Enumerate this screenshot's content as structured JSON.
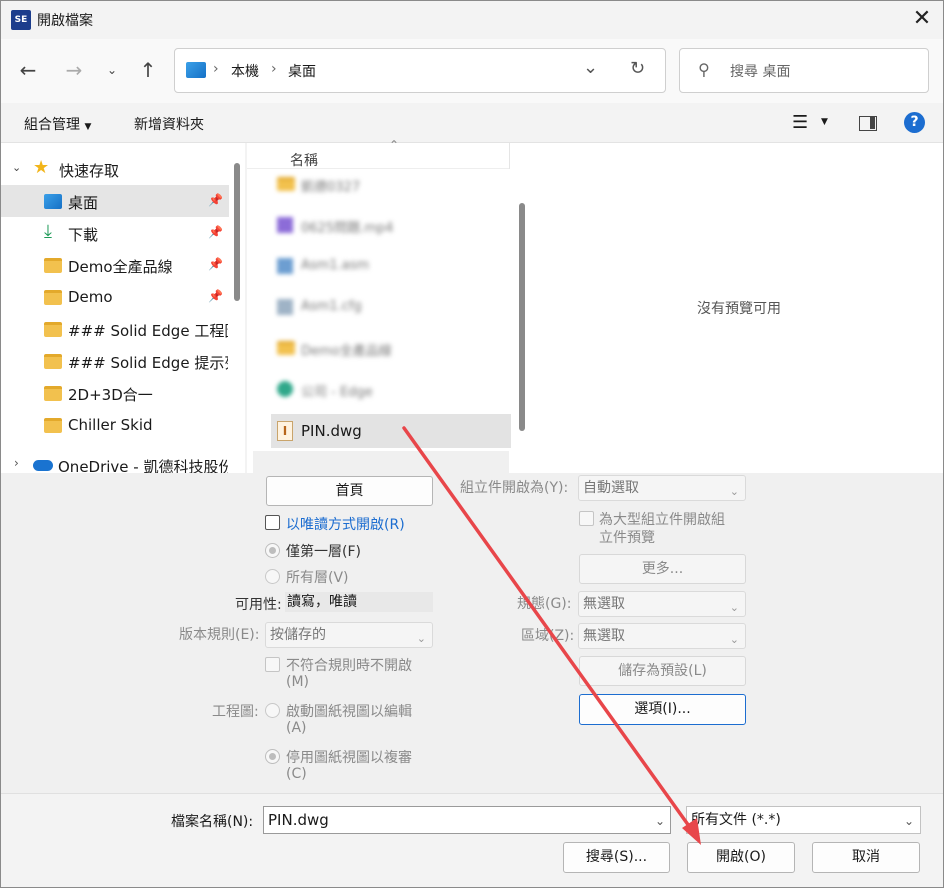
{
  "window": {
    "title": "開啟檔案",
    "app_icon_text": "SE"
  },
  "address": {
    "crumbs": [
      "本機",
      "桌面"
    ],
    "separator": "›"
  },
  "search": {
    "placeholder": "搜尋 桌面"
  },
  "toolbar": {
    "organize": "組合管理",
    "new_folder": "新增資料夾"
  },
  "nav": {
    "quick_access": "快速存取",
    "items": [
      {
        "label": "桌面",
        "pinned": true,
        "selected": true
      },
      {
        "label": "下載",
        "pinned": true
      },
      {
        "label": "Demo全產品線",
        "pinned": true
      },
      {
        "label": "Demo",
        "pinned": true
      },
      {
        "label": "### Solid Edge 工程圖"
      },
      {
        "label": "### Solid Edge 提示列"
      },
      {
        "label": "2D+3D合一"
      },
      {
        "label": "Chiller Skid"
      }
    ],
    "onedrive": "OneDrive - 凱德科技股份"
  },
  "files": {
    "header_name": "名稱",
    "rows": [
      {
        "label": "凱德0327",
        "blurred": true
      },
      {
        "label": "0625問題.mp4",
        "blurred": true
      },
      {
        "label": "Asm1.asm",
        "blurred": true
      },
      {
        "label": "Asm1.cfg",
        "blurred": true
      },
      {
        "label": "Demo全產品線",
        "blurred": true
      },
      {
        "label": "公司 - Edge",
        "blurred": true
      },
      {
        "label": "PIN.dwg",
        "selected": true
      }
    ]
  },
  "preview": {
    "empty": "沒有預覽可用"
  },
  "options": {
    "home_button": "首頁",
    "readonly": "以唯讀方式開啟(R)",
    "first_level": "僅第一層(F)",
    "all_levels": "所有層(V)",
    "availability_label": "可用性:",
    "availability_value": "讀寫，唯讀",
    "revision_rule_label": "版本規則(E):",
    "revision_rule_value": "按儲存的",
    "no_open_nonmatch_1": "不符合規則時不開啟",
    "no_open_nonmatch_2": "(M)",
    "drawing_label": "工程圖:",
    "activate_edit_1": "啟動圖紙視圖以編輯",
    "activate_edit_2": "(A)",
    "inactivate_review_1": "停用圖紙視圖以複審",
    "inactivate_review_2": "(C)",
    "assembly_open_label": "組立件開啟為(Y):",
    "assembly_open_value": "自動選取",
    "large_asm_1": "為大型組立件開啟組",
    "large_asm_2": "立件預覽",
    "more": "更多...",
    "config_label": "規態(G):",
    "config_value": "無選取",
    "zone_label": "區域(Z):",
    "zone_value": "無選取",
    "save_default": "儲存為預設(L)",
    "options_button": "選項(I)..."
  },
  "footer": {
    "filename_label": "檔案名稱(N):",
    "filename_value": "PIN.dwg",
    "filetype_value": "所有文件 (*.*)",
    "search_button": "搜尋(S)...",
    "open_button": "開啟(O)",
    "cancel_button": "取消"
  },
  "colors": {
    "accent": "#1c6dd0",
    "selected_bg": "#e5e5e5",
    "arrow": "#e8464a"
  }
}
